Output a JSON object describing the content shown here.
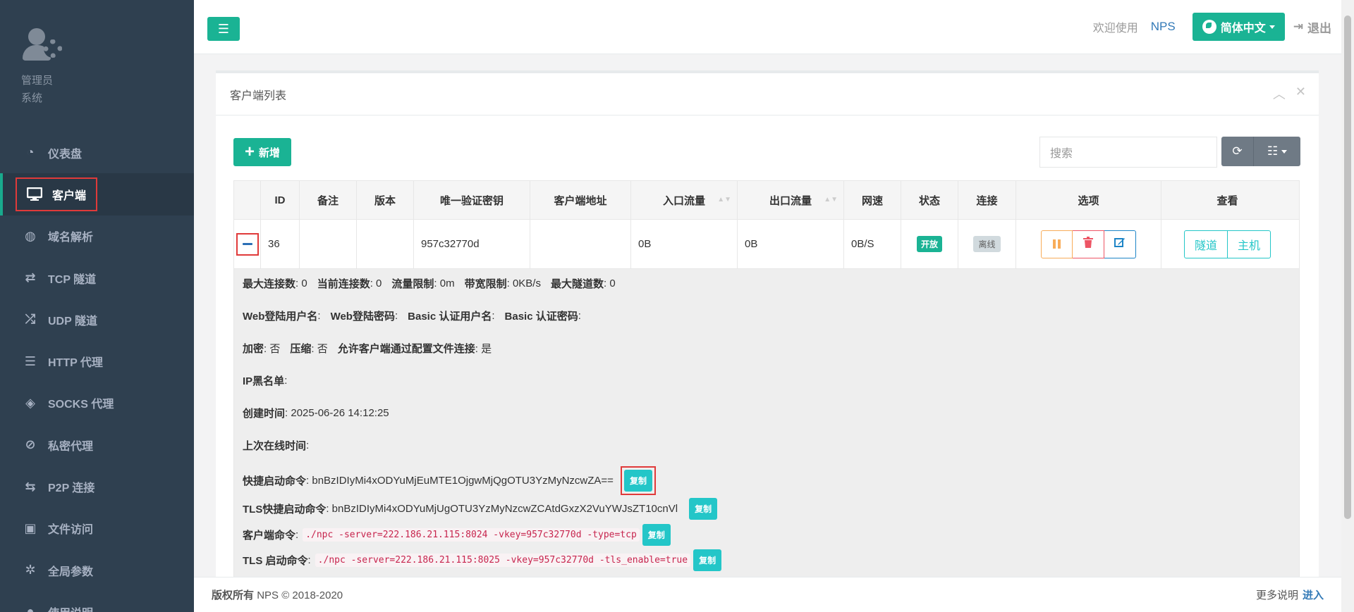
{
  "profile": {
    "role": "管理员",
    "sub": "系统"
  },
  "nav": [
    {
      "label": "仪表盘",
      "icon": "dashboard-icon"
    },
    {
      "label": "客户端",
      "icon": "monitor-icon"
    },
    {
      "label": "域名解析",
      "icon": "globe-icon"
    },
    {
      "label": "TCP 隧道",
      "icon": "retweet-icon"
    },
    {
      "label": "UDP 隧道",
      "icon": "random-icon"
    },
    {
      "label": "HTTP 代理",
      "icon": "server-icon"
    },
    {
      "label": "SOCKS 代理",
      "icon": "layers-icon"
    },
    {
      "label": "私密代理",
      "icon": "eye-slash-icon"
    },
    {
      "label": "P2P 连接",
      "icon": "exchange-icon"
    },
    {
      "label": "文件访问",
      "icon": "briefcase-icon"
    },
    {
      "label": "全局参数",
      "icon": "gear-icon"
    },
    {
      "label": "使用说明",
      "icon": "info-icon"
    }
  ],
  "topbar": {
    "welcome": "欢迎使用",
    "brand": "NPS",
    "language": "简体中文",
    "logout": "退出"
  },
  "panel": {
    "title": "客户端列表",
    "add_label": "新增",
    "search_placeholder": "搜索"
  },
  "table": {
    "headers": [
      "ID",
      "备注",
      "版本",
      "唯一验证密钥",
      "客户端地址",
      "入口流量",
      "出口流量",
      "网速",
      "状态",
      "连接",
      "选项",
      "查看"
    ],
    "row": {
      "id": "36",
      "remark": "",
      "version": "",
      "vkey": "957c32770d",
      "address": "",
      "inflow": "0B",
      "outflow": "0B",
      "speed": "0B/S",
      "status": "开放",
      "connection": "离线",
      "view_tunnel": "隧道",
      "view_host": "主机"
    }
  },
  "detail": {
    "max_conn_label": "最大连接数",
    "max_conn": ": 0",
    "cur_conn_label": "当前连接数",
    "cur_conn": ": 0",
    "flow_limit_label": "流量限制",
    "flow_limit": ": 0m",
    "rate_limit_label": "带宽限制",
    "rate_limit": ": 0KB/s",
    "max_tunnel_label": "最大隧道数",
    "max_tunnel": ": 0",
    "web_user_label": "Web登陆用户名",
    "web_user": ":",
    "web_pass_label": "Web登陆密码",
    "web_pass": ":",
    "basic_user_label": "Basic 认证用户名",
    "basic_user": ":",
    "basic_pass_label": "Basic 认证密码",
    "basic_pass": ":",
    "crypt_label": "加密",
    "crypt": ": 否",
    "compress_label": "压缩",
    "compress": ": 否",
    "config_conn_label": "允许客户端通过配置文件连接",
    "config_conn": ": 是",
    "ip_black_label": "IP黑名单",
    "ip_black": ":",
    "create_time_label": "创建时间",
    "create_time": ": 2025-06-26 14:12:25",
    "last_online_label": "上次在线时间",
    "last_online": ":",
    "quick_cmd_label": "快捷启动命令",
    "quick_cmd": ": bnBzIDIyMi4xODYuMjEuMTE1OjgwMjQgOTU3YzMyNzcwZA==",
    "tls_quick_cmd_label": "TLS快捷启动命令",
    "tls_quick_cmd": ": bnBzIDIyMi4xODYuMjUgOTU3YzMyNzcwZCAtdGxzX2VuYWJsZT10cnVl",
    "client_cmd_label": "客户端命令",
    "client_cmd": "./npc -server=222.186.21.115:8024 -vkey=957c32770d -type=tcp",
    "tls_cmd_label": "TLS 启动命令",
    "tls_cmd": "./npc -server=222.186.21.115:8025 -vkey=957c32770d -tls_enable=true",
    "copy_label": "复制"
  },
  "footer": {
    "copyright_label": "版权所有",
    "copyright": "NPS © 2018-2020",
    "more": "更多说明",
    "enter": "进入"
  },
  "colors": {
    "sidebar": "#2f4050",
    "accent": "#1ab394",
    "info": "#23c6c8",
    "danger": "#ed5565",
    "warning": "#f8ac59"
  }
}
